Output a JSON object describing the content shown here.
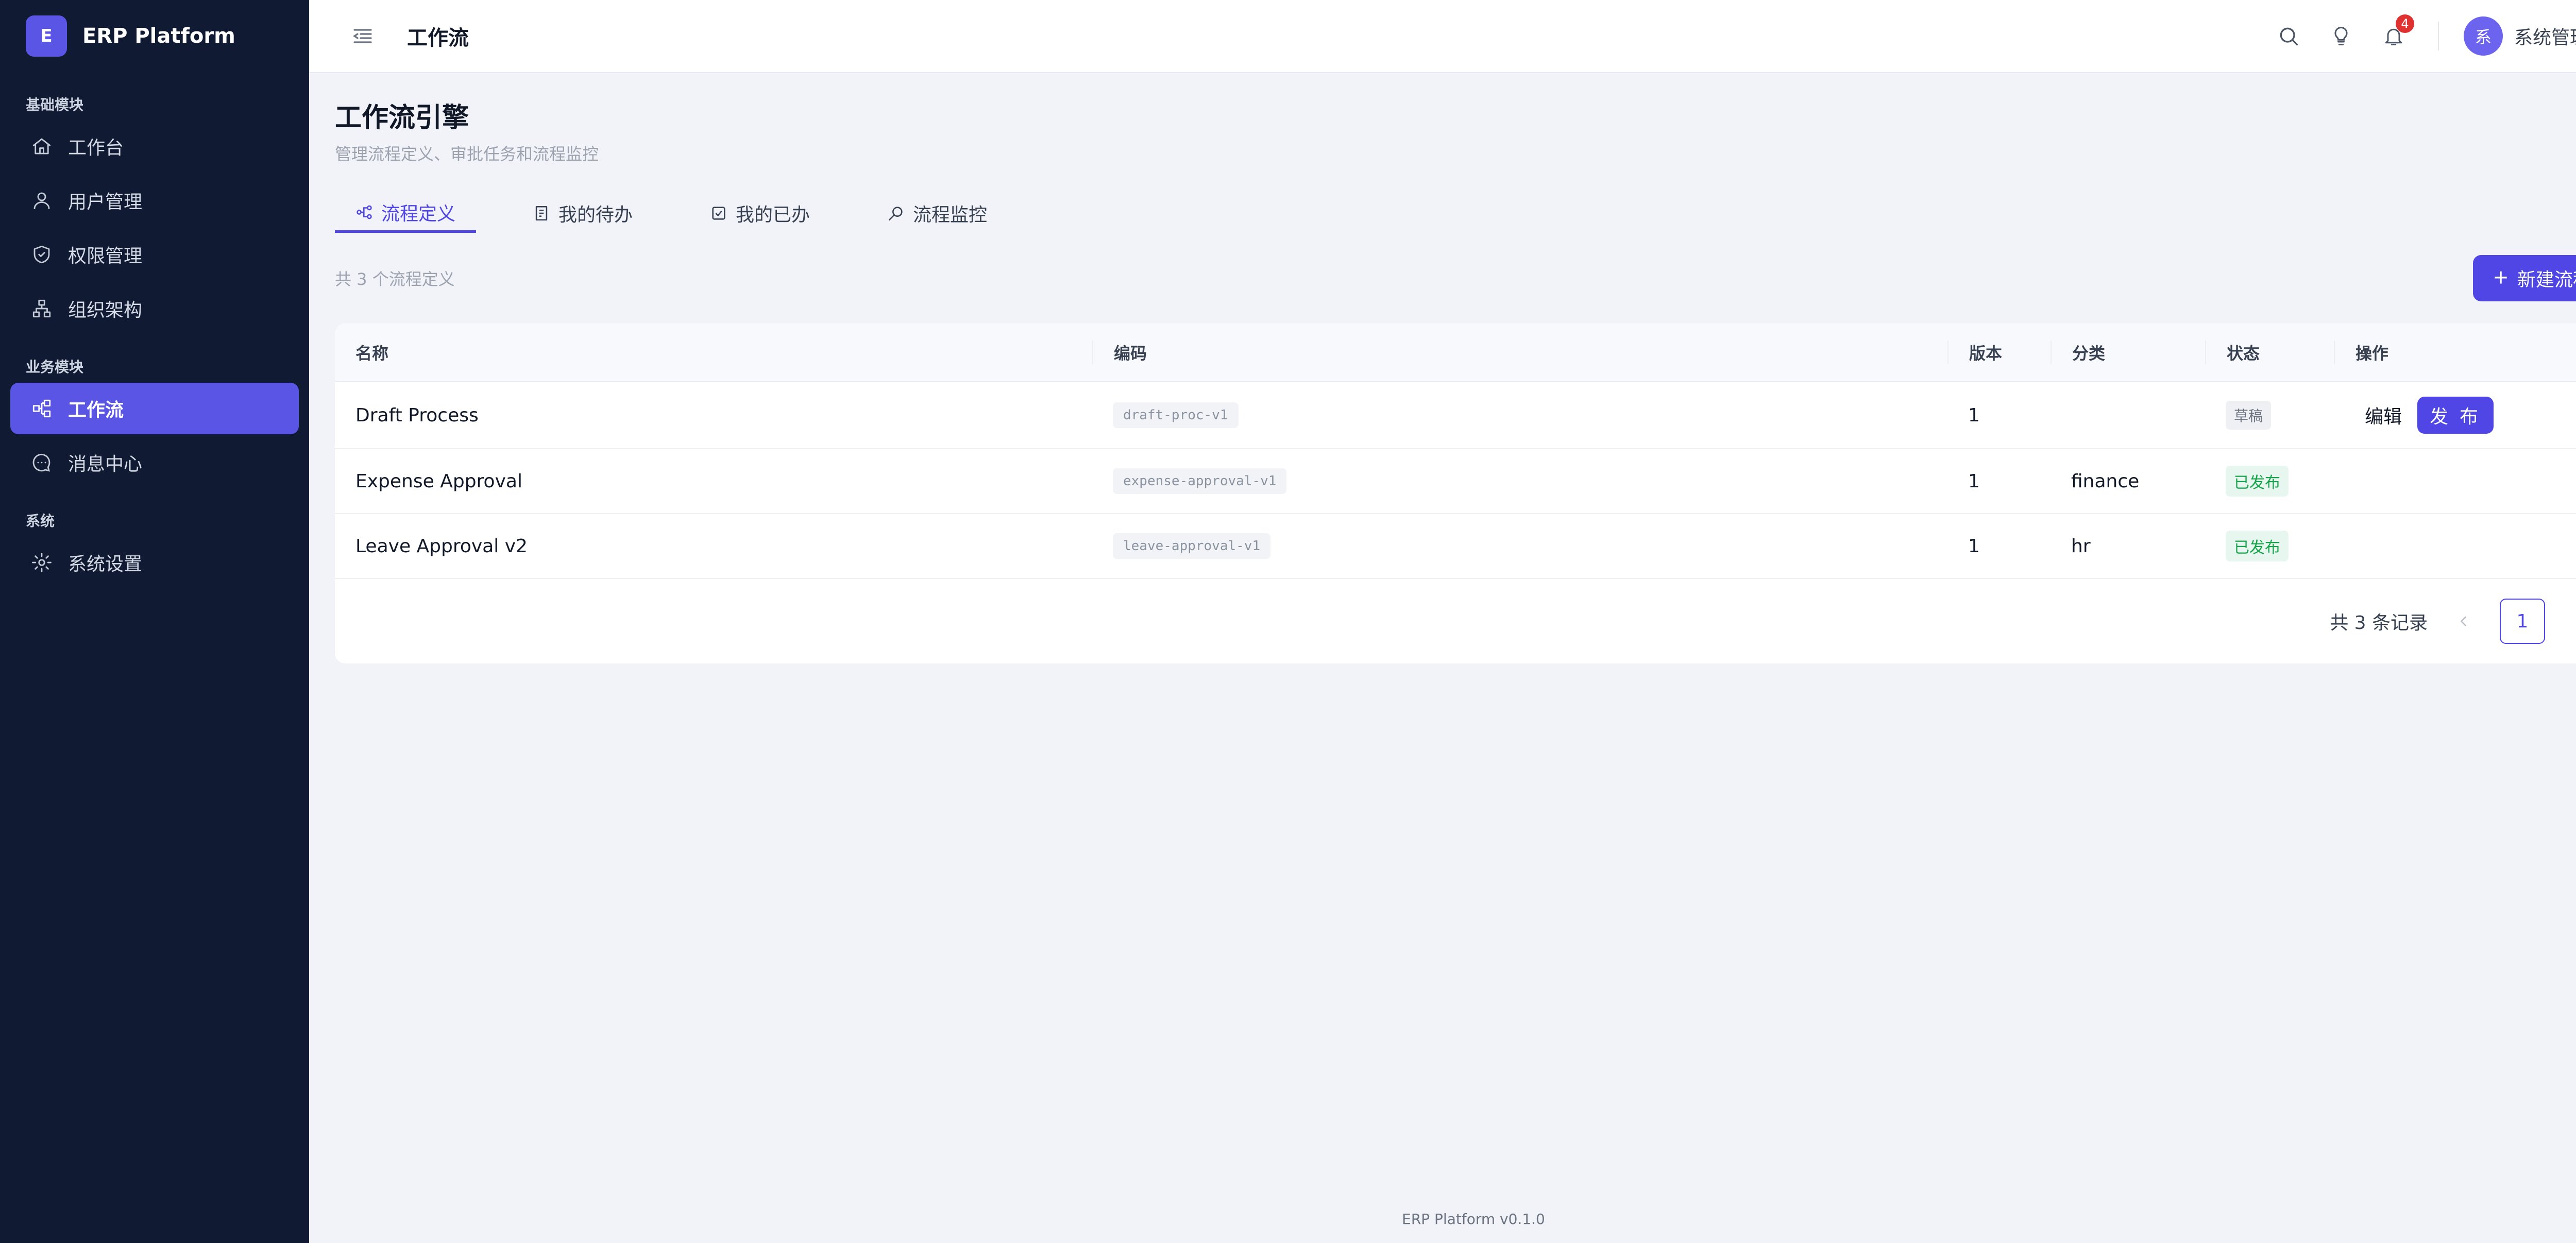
{
  "brand": {
    "logo_letter": "E",
    "name": "ERP Platform"
  },
  "sidebar": {
    "groups": [
      {
        "label": "基础模块",
        "items": [
          {
            "label": "工作台",
            "icon": "home-icon"
          },
          {
            "label": "用户管理",
            "icon": "user-icon"
          },
          {
            "label": "权限管理",
            "icon": "shield-icon"
          },
          {
            "label": "组织架构",
            "icon": "org-chart-icon"
          }
        ]
      },
      {
        "label": "业务模块",
        "items": [
          {
            "label": "工作流",
            "icon": "workflow-icon",
            "active": true
          },
          {
            "label": "消息中心",
            "icon": "message-icon"
          }
        ]
      },
      {
        "label": "系统",
        "items": [
          {
            "label": "系统设置",
            "icon": "gear-icon"
          }
        ]
      }
    ]
  },
  "topbar": {
    "title": "工作流",
    "notification_count": "4",
    "user": {
      "avatar_text": "系",
      "name": "系统管理员"
    }
  },
  "page": {
    "title": "工作流引擎",
    "subtitle": "管理流程定义、审批任务和流程监控"
  },
  "tabs": [
    {
      "label": "流程定义",
      "icon": "workflow-icon",
      "active": true
    },
    {
      "label": "我的待办",
      "icon": "todo-icon"
    },
    {
      "label": "我的已办",
      "icon": "done-icon"
    },
    {
      "label": "流程监控",
      "icon": "monitor-icon"
    }
  ],
  "toolbar": {
    "count_text": "共 3 个流程定义",
    "new_button": "新建流程"
  },
  "table": {
    "columns": {
      "name": "名称",
      "code": "编码",
      "version": "版本",
      "category": "分类",
      "status": "状态",
      "actions": "操作"
    },
    "rows": [
      {
        "name": "Draft Process",
        "code": "draft-proc-v1",
        "version": "1",
        "category": "",
        "status": "草稿",
        "edit": "编辑",
        "publish": "发 布"
      },
      {
        "name": "Expense Approval",
        "code": "expense-approval-v1",
        "version": "1",
        "category": "finance",
        "status": "已发布"
      },
      {
        "name": "Leave Approval v2",
        "code": "leave-approval-v1",
        "version": "1",
        "category": "hr",
        "status": "已发布"
      }
    ]
  },
  "pagination": {
    "total_text": "共 3 条记录",
    "current_page": "1"
  },
  "footer": {
    "text": "ERP Platform v0.1.0"
  },
  "colors": {
    "sidebar_bg": "#111a33",
    "accent": "#4f46e5",
    "active_nav": "#5b55e6",
    "success": "#16a34a"
  }
}
